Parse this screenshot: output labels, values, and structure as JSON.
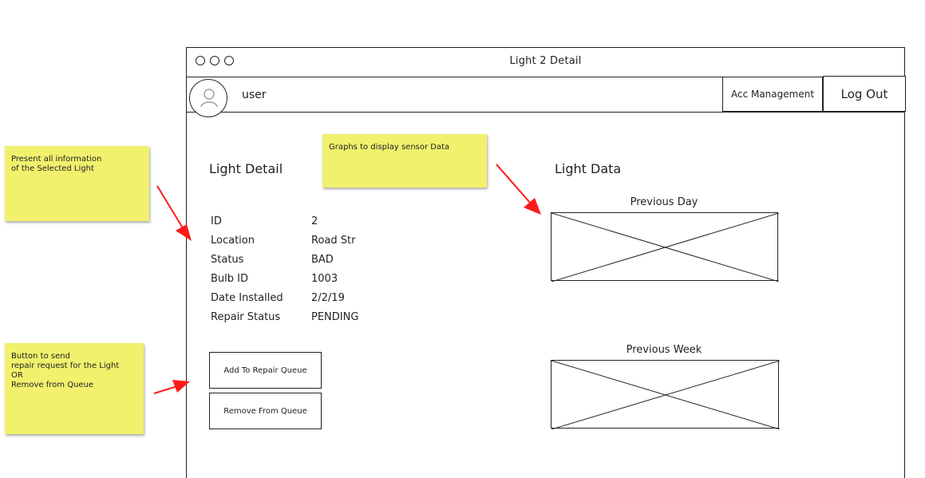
{
  "window": {
    "title": "Light 2 Detail"
  },
  "userbar": {
    "username": "user",
    "acc_management_label": "Acc Management",
    "logout_label": "Log Out"
  },
  "detail": {
    "title": "Light Detail",
    "fields": [
      {
        "label": "ID",
        "value": "2"
      },
      {
        "label": "Location",
        "value": "Road Str"
      },
      {
        "label": "Status",
        "value": "BAD"
      },
      {
        "label": "Bulb ID",
        "value": "1003"
      },
      {
        "label": "Date Installed",
        "value": "2/2/19"
      },
      {
        "label": "Repair Status",
        "value": "PENDING"
      }
    ],
    "add_button_label": "Add To Repair Queue",
    "remove_button_label": "Remove From Queue"
  },
  "data_panel": {
    "title": "Light Data",
    "graphs": [
      {
        "label": "Previous Day"
      },
      {
        "label": "Previous Week"
      }
    ]
  },
  "notes": [
    {
      "text": "Present all information\nof the Selected Light"
    },
    {
      "text": "Graphs to display sensor Data"
    },
    {
      "text": "Button to send\nrepair request for the Light\nOR\nRemove from Queue"
    }
  ],
  "colors": {
    "note": "#f1f16e",
    "arrow": "#ff1a1a",
    "stroke": "#222222"
  }
}
